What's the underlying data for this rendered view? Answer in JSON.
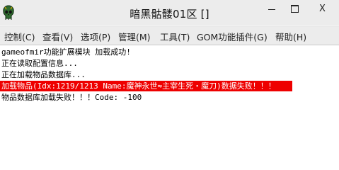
{
  "window": {
    "title": "暗黑骷髅01区 []",
    "close_glyph": "X"
  },
  "menu": [
    "控制(C)",
    "查看(V)",
    "选项(P)",
    "管理(M)",
    "工具(T)",
    "GOM功能插件(G)",
    "帮助(H)"
  ],
  "log": [
    "gameofmir功能扩展模块 加载成功!",
    "正在读取配置信息...",
    "正在加载物品数据库...",
    "加载物品(Idx:1219/1213 Name:魔神永世≈主宰生死・魔刀)数据失败！！！",
    "物品数据库加载失败！！！Code: -100"
  ],
  "colors": {
    "error_highlight": "#ee0000",
    "error_text": "#ffffff"
  }
}
